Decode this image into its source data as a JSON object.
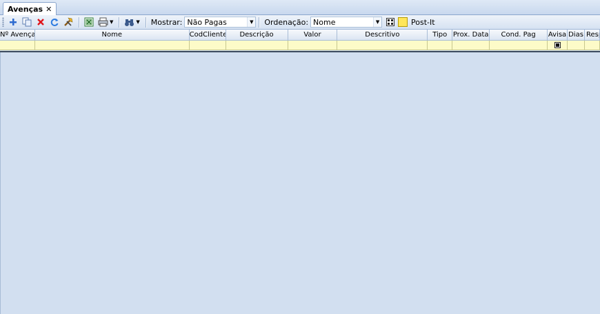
{
  "tab": {
    "title": "Avenças",
    "close": "✕"
  },
  "toolbar": {
    "buttons": [
      {
        "name": "add-icon",
        "glyph": "+"
      },
      {
        "name": "copy-icon",
        "glyph": "⧉"
      },
      {
        "name": "delete-icon",
        "glyph": "✕"
      },
      {
        "name": "refresh-icon",
        "glyph": "⟳"
      },
      {
        "name": "tools-icon",
        "glyph": "⚒"
      },
      {
        "name": "excel-icon",
        "glyph": "▦"
      },
      {
        "name": "print-icon",
        "glyph": "⎙"
      },
      {
        "name": "binoculars-icon",
        "glyph": "⚲"
      }
    ],
    "mostrar_label": "Mostrar:",
    "mostrar_value": "Não Pagas",
    "ordenacao_label": "Ordenação:",
    "ordenacao_value": "Nome",
    "postit_label": "Post-It"
  },
  "grid": {
    "columns": [
      "Nº Avença",
      "Nome",
      "CodCliente",
      "Descrição",
      "Valor",
      "Descritivo",
      "Tipo",
      "Prox. Data",
      "Cond. Pag",
      "Avisa",
      "Dias",
      "Resp"
    ],
    "filter_row_avisa_checked": true
  },
  "colors": {
    "accent": "#2c5aa0",
    "background": "#d2dff0",
    "filter_row": "#fdfbc8"
  }
}
